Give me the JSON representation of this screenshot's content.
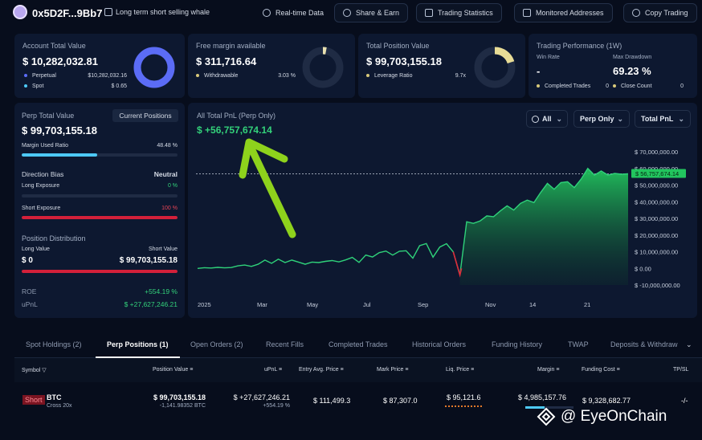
{
  "header": {
    "address": "0x5D2F...9Bb7",
    "tagline": "Long term short selling whale",
    "buttons": {
      "realtime": "Real-time Data",
      "share": "Share & Earn",
      "stats": "Trading Statistics",
      "monitored": "Monitored Addresses",
      "copy": "Copy Trading"
    }
  },
  "account": {
    "title": "Account Total Value",
    "value": "$ 10,282,032.81",
    "perpetual_label": "Perpetual",
    "perpetual_value": "$10,282,032.16",
    "spot_label": "Spot",
    "spot_value": "$ 0.65",
    "donut_fraction": 0.999,
    "colors": {
      "perpetual": "#5b6cf6",
      "spot": "#4dc9f6"
    }
  },
  "margin": {
    "title": "Free margin available",
    "value": "$ 311,716.64",
    "withdrawable_label": "Withdrawable",
    "withdrawable_pct": "3.03 %",
    "donut_fraction": 0.03
  },
  "position": {
    "title": "Total Position Value",
    "value": "$ 99,703,155.18",
    "leverage_label": "Leverage Ratio",
    "leverage_value": "9.7x",
    "donut_fraction": 0.2
  },
  "performance": {
    "title": "Trading Performance (1W)",
    "win_rate_label": "Win Rate",
    "win_rate_value": "-",
    "drawdown_label": "Max Drawdown",
    "drawdown_value": "69.23 %",
    "completed_label": "Completed Trades",
    "completed_value": "0",
    "close_label": "Close Count",
    "close_value": "0"
  },
  "perp": {
    "title": "Perp Total Value",
    "current_positions_btn": "Current Positions",
    "value": "$ 99,703,155.18",
    "margin_used_label": "Margin Used Ratio",
    "margin_used_value": "48.48 %",
    "margin_used_fraction": 0.4848,
    "direction_label": "Direction Bias",
    "direction_value": "Neutral",
    "long_exposure_label": "Long Exposure",
    "long_exposure_value": "0 %",
    "short_exposure_label": "Short Exposure",
    "short_exposure_value": "100 %",
    "distribution_title": "Position Distribution",
    "long_value_label": "Long Value",
    "short_value_label": "Short Value",
    "long_value": "$ 0",
    "short_value": "$ 99,703,155.18",
    "roe_label": "ROE",
    "roe_value": "+554.19 %",
    "upnl_label": "uPnL",
    "upnl_value": "$ +27,627,246.21"
  },
  "pnl_chart": {
    "title": "All Total PnL (Perp Only)",
    "value": "$ +56,757,674.14",
    "filters": {
      "range": "All",
      "scope": "Perp Only",
      "metric": "Total PnL"
    },
    "current_label": "$ 56,757,674.14"
  },
  "chart_data": {
    "type": "area",
    "title": "All Total PnL (Perp Only)",
    "x_labels": [
      "2025",
      "Mar",
      "May",
      "Jul",
      "Sep",
      "Nov",
      "14",
      "21"
    ],
    "y_labels": [
      "$ 70,000,000.00",
      "$ 60,000,000.00",
      "$ 50,000,000.00",
      "$ 40,000,000.00",
      "$ 30,000,000.00",
      "$ 20,000,000.00",
      "$ 10,000,000.00",
      "$ 0.00",
      "$ -10,000,000.00"
    ],
    "ylim": [
      -10000000,
      70000000
    ],
    "current_value": 56757674.14,
    "series": [
      {
        "values": [
          0,
          400000,
          200000,
          600000,
          300000,
          500000,
          1500000,
          2000000,
          1200000,
          2500000,
          5000000,
          3000000,
          5500000,
          3500000,
          5000000,
          3800000,
          2500000,
          3800000,
          3500000,
          4200000,
          4700000,
          3900000,
          5100000,
          6600000,
          3600000,
          8000000,
          6800000,
          9400000,
          10400000,
          8000000,
          10300000,
          10600000,
          6100000,
          13600000,
          14900000,
          6700000,
          12800000,
          14800000,
          9900000,
          -4000000,
          28000000,
          27000000,
          28500000,
          31500000,
          31000000,
          34500000,
          37500000,
          35000000,
          39000000,
          41000000,
          39500000,
          45500000,
          51000000,
          47500000,
          51500000,
          52000000,
          48500000,
          53500000,
          60000000,
          56000000,
          58500000,
          56000000,
          57000000,
          56500000,
          56757674.14
        ]
      }
    ],
    "annotation": "green arrow pointing at the total PnL value"
  },
  "tabs": [
    "Spot Holdings (2)",
    "Perp Positions (1)",
    "Open Orders (2)",
    "Recent Fills",
    "Completed Trades",
    "Historical Orders",
    "Funding History",
    "TWAP",
    "Deposits & Withdraw"
  ],
  "table": {
    "headers": [
      "Symbol",
      "Position Value",
      "uPnL",
      "Entry Avg. Price",
      "Mark Price",
      "Liq. Price",
      "Margin",
      "Funding Cost",
      "TP/SL"
    ],
    "row": {
      "side": "Short",
      "symbol": "BTC",
      "leverage": "Cross 20x",
      "position_value": "$ 99,703,155.18",
      "position_size": "-1,141.98352 BTC",
      "upnl": "$ +27,627,246.21",
      "upnl_pct": "+554.19 %",
      "entry_price": "$ 111,499.3",
      "mark_price": "$ 87,307.0",
      "liq_price": "$ 95,121.6",
      "margin": "$ 4,985,157.76",
      "funding_cost": "$ 9,328,682.77",
      "tpsl": "-/-"
    }
  },
  "watermark": "@ EyeOnChain"
}
